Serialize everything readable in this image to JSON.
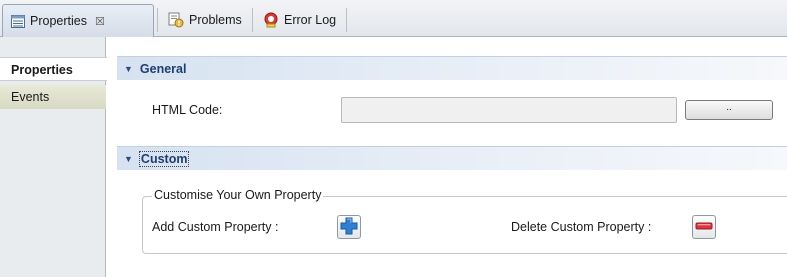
{
  "tabs": [
    {
      "label": "Properties",
      "icon": "properties-icon",
      "close": "☒"
    },
    {
      "label": "Problems",
      "icon": "problems-icon"
    },
    {
      "label": "Error Log",
      "icon": "error-log-icon"
    }
  ],
  "left_tabs": [
    {
      "label": "Properties"
    },
    {
      "label": "Events"
    }
  ],
  "sections": {
    "general": {
      "title": "General",
      "html_code_label": "HTML Code:",
      "html_code_value": "",
      "browse_label": ".."
    },
    "custom": {
      "title": "Custom",
      "group_title": "Customise Your Own Property",
      "add_label": "Add Custom Property :",
      "delete_label": "Delete Custom Property :"
    }
  },
  "colors": {
    "section_title": "#1f3e6d",
    "add_icon": "#2f7fd4",
    "delete_icon": "#d9363e"
  }
}
